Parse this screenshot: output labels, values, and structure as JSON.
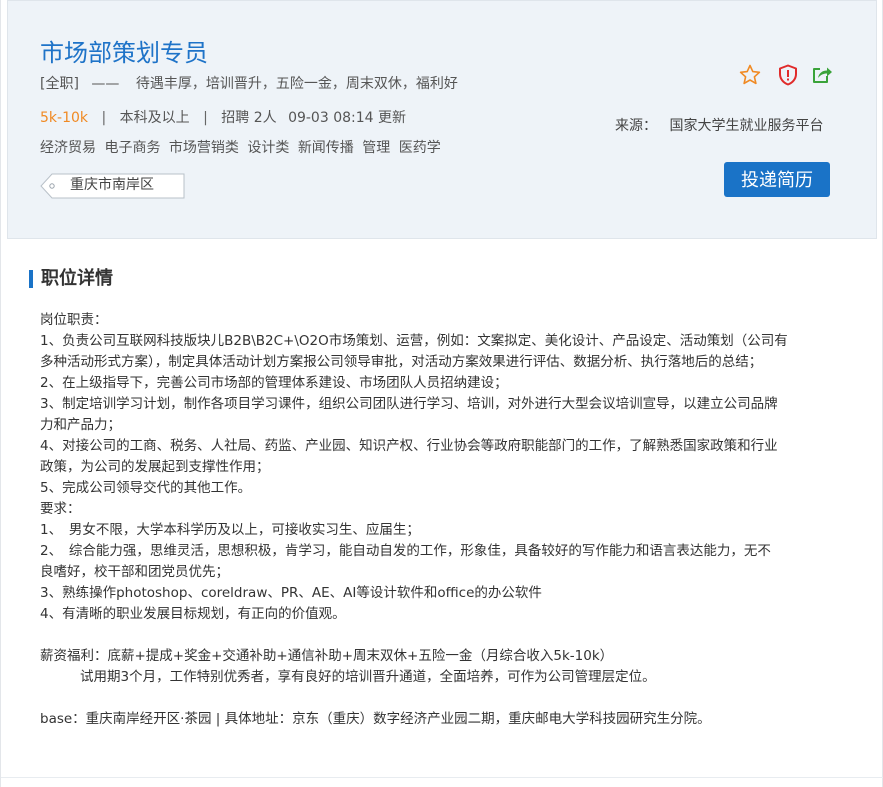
{
  "job": {
    "title": "市场部策划专员",
    "type": "[全职]",
    "dash": "——",
    "perks": "待遇丰厚，培训晋升，五险一金，周末双休，福利好",
    "salary": "5k-10k",
    "education": "本科及以上",
    "hiring": "招聘 2人",
    "updated": "09-03 08:14 更新",
    "separator": "|",
    "categories": [
      "经济贸易",
      "电子商务",
      "市场营销类",
      "设计类",
      "新闻传播",
      "管理",
      "医药学"
    ],
    "location": "重庆市南岸区"
  },
  "source": {
    "label": "来源：",
    "value": "国家大学生就业服务平台"
  },
  "actions": {
    "apply_label": "投递简历",
    "icons": [
      "star-icon",
      "shield-alert-icon",
      "share-icon"
    ]
  },
  "colors": {
    "brand": "#1a73c7",
    "salary": "#f08a24",
    "report": "#e02b2b",
    "share": "#3aa33a"
  },
  "details": {
    "section_title": "职位详情",
    "lines": [
      "岗位职责：",
      "1、负责公司互联网科技版块儿B2B\\B2C+\\O2O市场策划、运营，例如：文案拟定、美化设计、产品设定、活动策划（公司有",
      "多种活动形式方案），制定具体活动计划方案报公司领导审批，对活动方案效果进行评估、数据分析、执行落地后的总结；",
      "2、在上级指导下，完善公司市场部的管理体系建设、市场团队人员招纳建设；",
      "3、制定培训学习计划，制作各项目学习课件，组织公司团队进行学习、培训，对外进行大型会议培训宣导，以建立公司品牌",
      "力和产品力；",
      "4、对接公司的工商、税务、人社局、药监、产业园、知识产权、行业协会等政府职能部门的工作，了解熟悉国家政策和行业",
      "政策，为公司的发展起到支撑性作用；",
      "5、完成公司领导交代的其他工作。",
      "要求：",
      "1、　男女不限，大学本科学历及以上，可接收实习生、应届生；",
      "2、　综合能力强，思维灵活，思想积极，肯学习，能自动自发的工作，形象佳，具备较好的写作能力和语言表达能力，无不",
      "良嗜好，校干部和团党员优先；",
      "3、熟练操作photoshop、coreldraw、PR、AE、AI等设计软件和office的办公软件",
      "4、有清晰的职业发展目标规划，有正向的价值观。",
      "",
      "薪资福利：底薪+提成+奖金+交通补助+通信补助+周末双休+五险一金（月综合收入5k-10k）",
      "试用期3个月，工作特别优秀者，享有良好的培训晋升通道，全面培养，可作为公司管理层定位。",
      "",
      "base：重庆南岸经开区·茶园 | 具体地址：京东（重庆）数字经济产业园二期，重庆邮电大学科技园研究生分院。"
    ]
  }
}
